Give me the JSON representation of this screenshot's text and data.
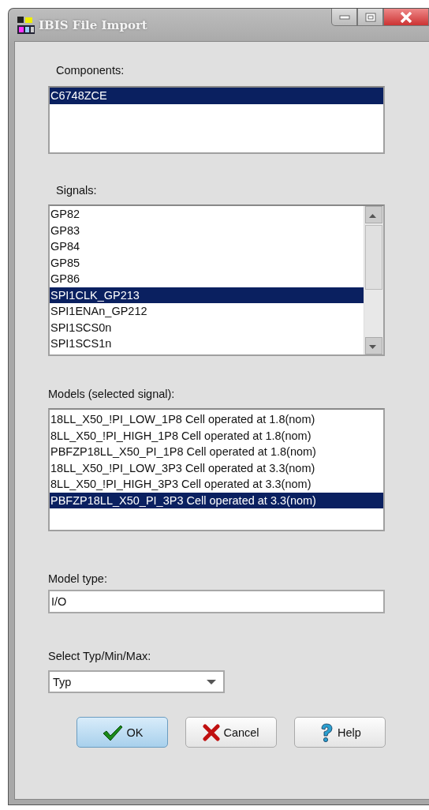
{
  "window": {
    "title": "IBIS File Import"
  },
  "components": {
    "label": "Components:",
    "items": [
      {
        "text": "C6748ZCE",
        "selected": true
      }
    ]
  },
  "signals": {
    "label": "Signals:",
    "items": [
      {
        "text": "GP82",
        "selected": false
      },
      {
        "text": "GP83",
        "selected": false
      },
      {
        "text": "GP84",
        "selected": false
      },
      {
        "text": "GP85",
        "selected": false
      },
      {
        "text": "GP86",
        "selected": false
      },
      {
        "text": "SPI1CLK_GP213",
        "selected": true
      },
      {
        "text": "SPI1ENAn_GP212",
        "selected": false
      },
      {
        "text": "SPI1SCS0n",
        "selected": false
      },
      {
        "text": "SPI1SCS1n",
        "selected": false
      }
    ]
  },
  "models": {
    "label": "Models (selected signal):",
    "items": [
      {
        "text": "18LL_X50_!PI_LOW_1P8 Cell operated at 1.8(nom)",
        "selected": false
      },
      {
        "text": "8LL_X50_!PI_HIGH_1P8 Cell operated at 1.8(nom)",
        "selected": false
      },
      {
        "text": "PBFZP18LL_X50_PI_1P8 Cell operated at 1.8(nom)",
        "selected": false
      },
      {
        "text": "18LL_X50_!PI_LOW_3P3 Cell operated at 3.3(nom)",
        "selected": false
      },
      {
        "text": "8LL_X50_!PI_HIGH_3P3 Cell operated at 3.3(nom)",
        "selected": false
      },
      {
        "text": "PBFZP18LL_X50_PI_3P3 Cell operated at 3.3(nom)",
        "selected": true
      }
    ]
  },
  "model_type": {
    "label": "Model type:",
    "value": "I/O"
  },
  "typ_min_max": {
    "label": "Select Typ/Min/Max:",
    "value": "Typ"
  },
  "buttons": [
    {
      "label": "OK",
      "kind": "ok",
      "default": true
    },
    {
      "label": "Cancel",
      "kind": "cancel",
      "default": false
    },
    {
      "label": "Help",
      "kind": "help",
      "default": false
    }
  ]
}
